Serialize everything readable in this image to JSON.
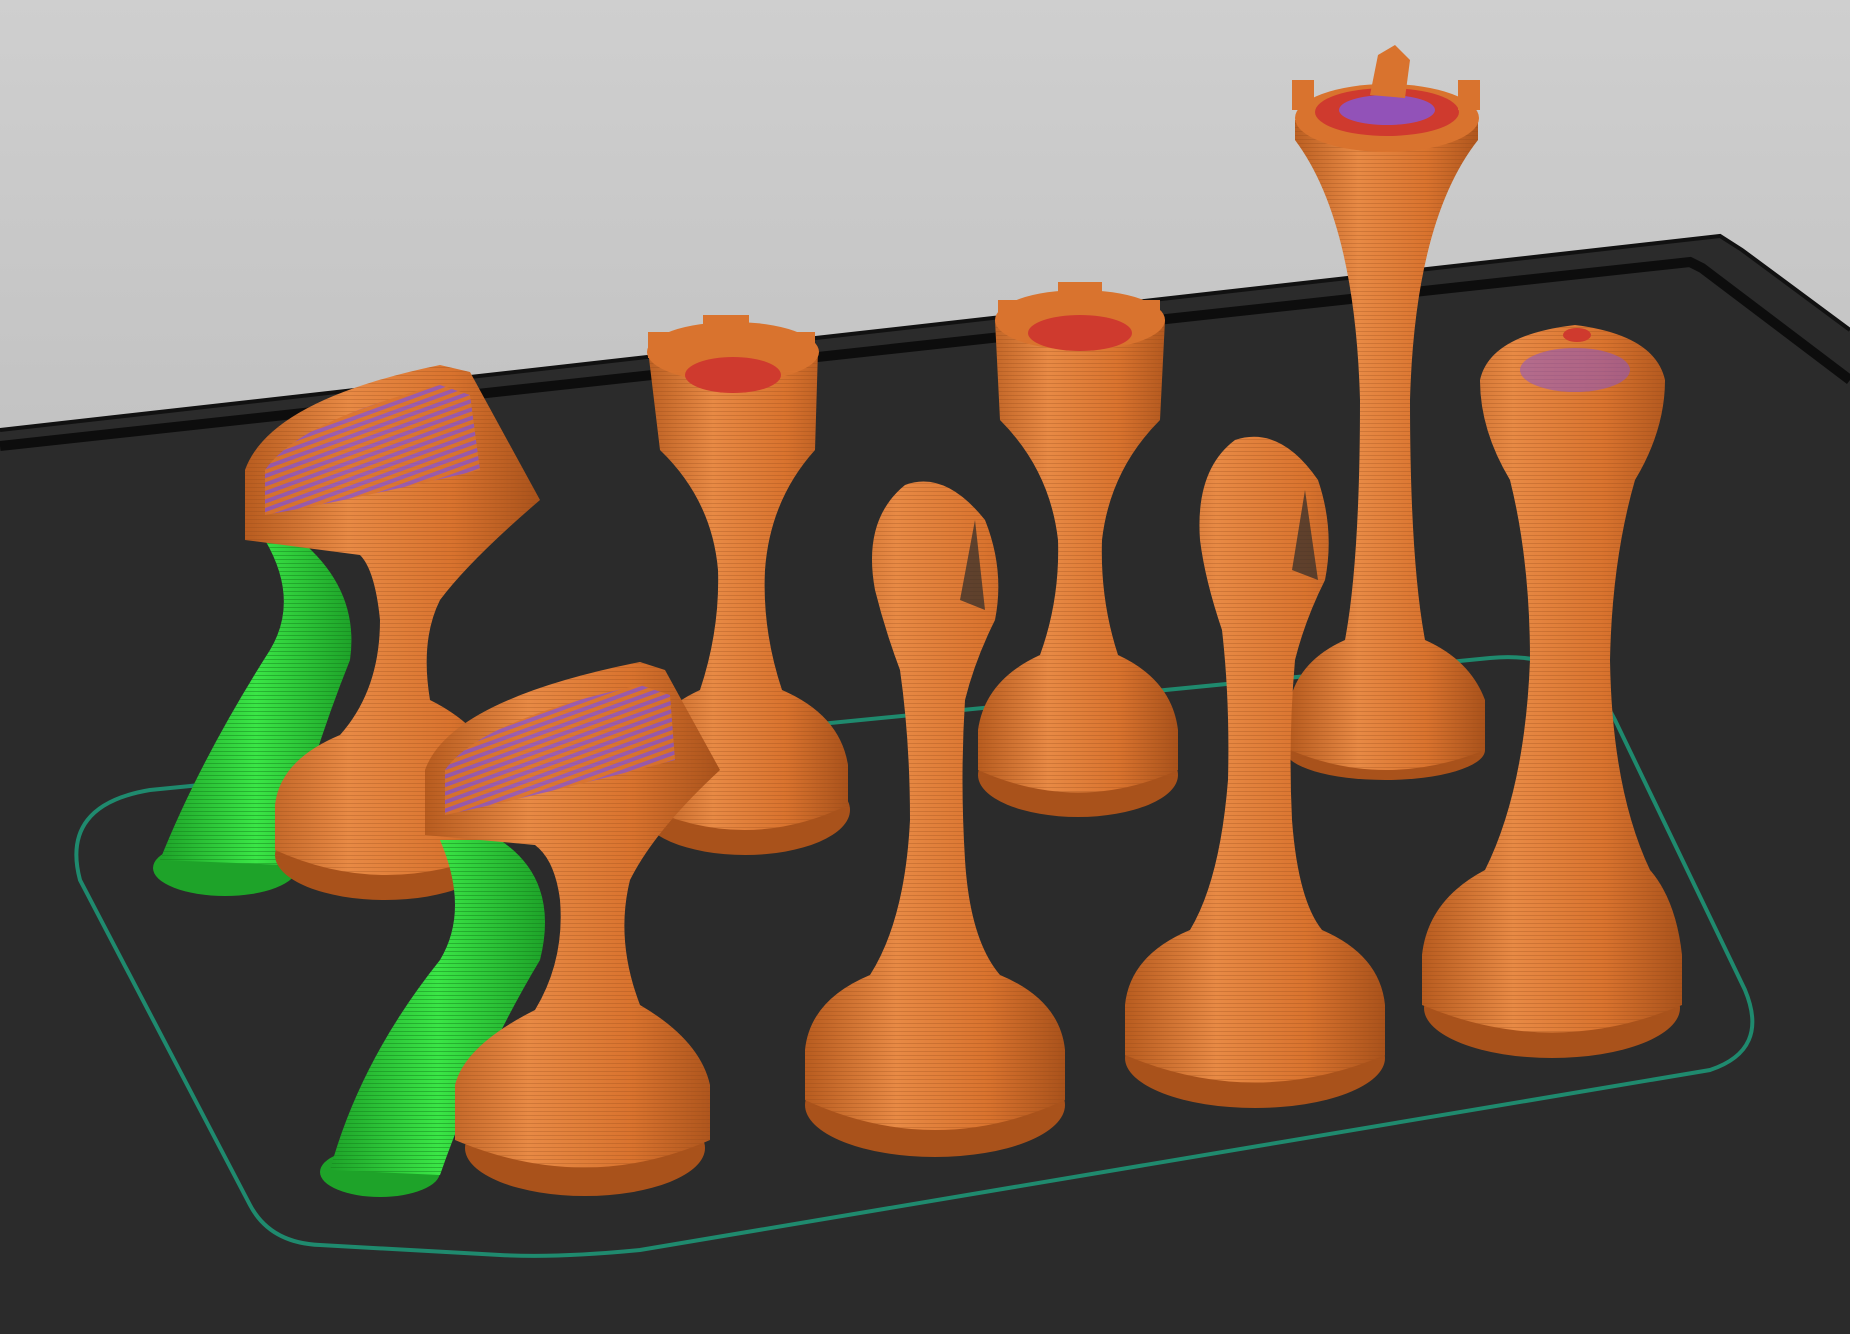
{
  "viewport": {
    "name": "slicer-gcode-preview",
    "background_top": "#cfcfcf",
    "background_bottom": "#a9a9a9",
    "bed_color": "#2b2b2b",
    "bed_edge_color": "#0d0d0d",
    "skirt_color": "#1f8a6e"
  },
  "colors": {
    "perimeter": "#d9732e",
    "perimeter_highlight": "#e88a45",
    "perimeter_shadow": "#b85c1f",
    "top_solid": "#cf3a2e",
    "internal": "#8b55c8",
    "support": "#2fd43a",
    "support_shadow": "#1ea329"
  },
  "pieces": [
    {
      "name": "knight-back",
      "kind": "knight",
      "support": true
    },
    {
      "name": "rook-left",
      "kind": "rook",
      "support": false
    },
    {
      "name": "rook-right",
      "kind": "rook",
      "support": false
    },
    {
      "name": "queen",
      "kind": "queen",
      "support": false
    },
    {
      "name": "knight-front",
      "kind": "knight",
      "support": true
    },
    {
      "name": "bishop-left",
      "kind": "bishop",
      "support": false
    },
    {
      "name": "bishop-right",
      "kind": "bishop",
      "support": false
    },
    {
      "name": "king-pawn",
      "kind": "pawn",
      "support": false
    }
  ]
}
